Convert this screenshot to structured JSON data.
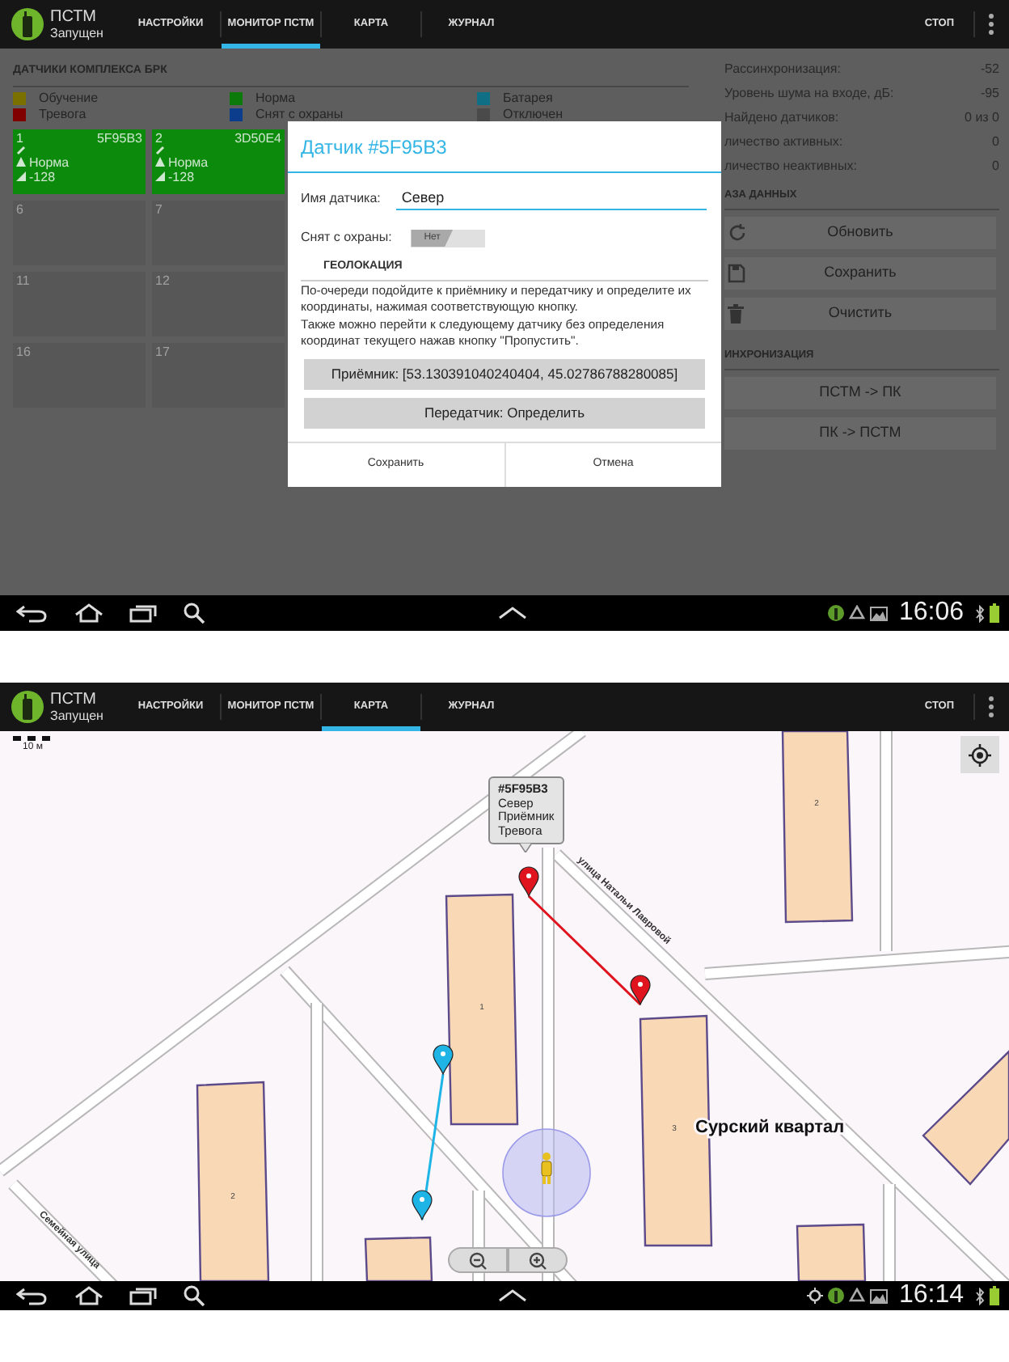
{
  "screens": [
    {
      "kind": "monitor",
      "app_bar": {
        "title": "ПСТМ",
        "subtitle": "Запущен",
        "tabs": [
          {
            "label": "НАСТРОЙКИ",
            "selected": false
          },
          {
            "label": "МОНИТОР ПСТМ",
            "selected": true
          },
          {
            "label": "КАРТА",
            "selected": false
          },
          {
            "label": "ЖУРНАЛ",
            "selected": false
          }
        ],
        "action": "СТОП"
      },
      "sensors": {
        "heading": "ДАТЧИКИ КОМПЛЕКСА БРК",
        "legend": [
          {
            "label": "Обучение",
            "color": "#7a7000"
          },
          {
            "label": "Норма",
            "color": "#0b7a0b"
          },
          {
            "label": "Батарея",
            "color": "#0f6f85"
          },
          {
            "label": "Тревога",
            "color": "#800000"
          },
          {
            "label": "Снят с охраны",
            "color": "#0b3d8c"
          },
          {
            "label": "Отключен",
            "color": "#4a4a4a"
          }
        ],
        "cells": [
          {
            "number": "1",
            "id": "5F95B3",
            "status": "Норма",
            "signal": "-128",
            "color": "#0b8a0b"
          },
          {
            "number": "2",
            "id": "3D50E4",
            "status": "Норма",
            "signal": "-128",
            "color": "#0b8a0b"
          },
          {
            "number": "6"
          },
          {
            "number": "7"
          },
          {
            "number": "11"
          },
          {
            "number": "12"
          },
          {
            "number": "16"
          },
          {
            "number": "17"
          }
        ]
      },
      "stats": [
        {
          "label": "Рассинхронизация:",
          "value": "-52"
        },
        {
          "label": "Уровень шума на входе, дБ:",
          "value": "-95"
        },
        {
          "label": "Найдено датчиков:",
          "value": "0 из 0"
        },
        {
          "label": "личество активных:",
          "value": "0"
        },
        {
          "label": "личество неактивных:",
          "value": "0"
        }
      ],
      "database": {
        "heading": "АЗА ДАННЫХ",
        "buttons": [
          "Обновить",
          "Сохранить",
          "Очистить"
        ]
      },
      "sync": {
        "heading": "ИНХРОНИЗАЦИЯ",
        "buttons": [
          "ПСТМ -> ПК",
          "ПК -> ПСТМ"
        ]
      },
      "dialog": {
        "title": "Датчик #5F95B3",
        "name_label": "Имя датчика:",
        "name_value": "Север",
        "guard_label": "Снят с охраны:",
        "guard_switch": {
          "label": "Нет",
          "on": false
        },
        "geo_heading": "ГЕОЛОКАЦИЯ",
        "instructions": [
          "По-очереди подойдите к приёмнику и передатчику и определите их координаты, нажимая соответствующую кнопку.",
          "Также можно перейти к следующему датчику без определения координат текущего нажав кнопку \"Пропустить\"."
        ],
        "geo_buttons": [
          "Приёмник: [53.130391040240404, 45.02786788280085]",
          "Передатчик: Определить"
        ],
        "footer_buttons": [
          "Сохранить",
          "Отмена"
        ]
      },
      "nav_bar": {
        "time": "16:06"
      }
    },
    {
      "kind": "map",
      "app_bar": {
        "title": "ПСТМ",
        "subtitle": "Запущен",
        "tabs": [
          {
            "label": "НАСТРОЙКИ",
            "selected": false
          },
          {
            "label": "МОНИТОР ПСТМ",
            "selected": false
          },
          {
            "label": "КАРТА",
            "selected": true
          },
          {
            "label": "ЖУРНАЛ",
            "selected": false
          }
        ],
        "action": "СТОП"
      },
      "map": {
        "scale": "10 м",
        "buildings": [
          "2",
          "1",
          "3",
          "2"
        ],
        "streets": [
          "улица Натальи Лавровой",
          "Семейная улица"
        ],
        "place": "Сурский квартал",
        "callout": {
          "title": "#5F95B3",
          "lines": [
            "Север",
            "Приёмник",
            "Тревога"
          ]
        },
        "markers": [
          {
            "color": "#e0141e"
          },
          {
            "color": "#e0141e"
          },
          {
            "color": "#1eb4e6"
          },
          {
            "color": "#1eb4e6"
          }
        ]
      },
      "nav_bar": {
        "time": "16:14"
      }
    }
  ]
}
